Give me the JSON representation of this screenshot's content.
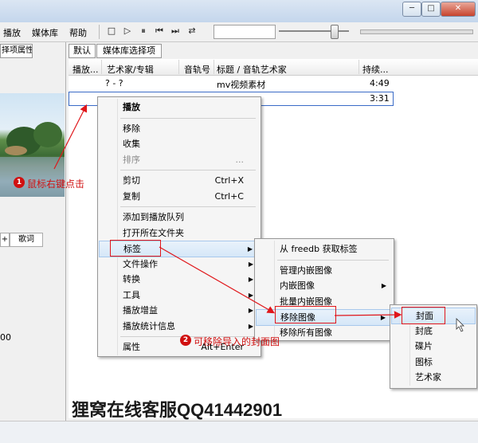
{
  "window": {
    "title": "",
    "buttons": [
      "─",
      "□",
      "✕"
    ]
  },
  "menubar": {
    "items": [
      "播放",
      "媒体库",
      "帮助"
    ]
  },
  "toolbar": {
    "icons": [
      "stop-icon",
      "play-icon",
      "pause-icon",
      "previous-icon",
      "next-icon",
      "random-icon"
    ],
    "glyphs": [
      "□",
      "▷",
      "⏸",
      "⏮",
      "⏭",
      "⇄"
    ],
    "volume_fraction": 0.78
  },
  "left_pane": {
    "tab": "择项属性",
    "lyric_tabs": [
      "+",
      "歌词"
    ],
    "number": "00"
  },
  "tabs": [
    "默认",
    "媒体库选择项"
  ],
  "columns": [
    "播放...",
    "艺术家/专辑",
    "音轨号",
    "标题 / 音轨艺术家",
    "持续..."
  ],
  "rows": [
    {
      "artist": "? - ?",
      "title": "mv视频素材",
      "duration": "4:49"
    },
    {
      "artist": "",
      "title": "",
      "duration": "3:31"
    }
  ],
  "context_menu": {
    "items": [
      {
        "label": "播放",
        "bold": true
      },
      {
        "sep": true
      },
      {
        "label": "移除"
      },
      {
        "label": "收集"
      },
      {
        "label": "排序",
        "shortcut": "...",
        "disabled": true
      },
      {
        "sep": true
      },
      {
        "label": "剪切",
        "shortcut": "Ctrl+X"
      },
      {
        "label": "复制",
        "shortcut": "Ctrl+C"
      },
      {
        "sep": true
      },
      {
        "label": "添加到播放队列"
      },
      {
        "label": "打开所在文件夹"
      },
      {
        "label": "标签",
        "submenu": true,
        "highlight": true
      },
      {
        "label": "文件操作",
        "submenu": true
      },
      {
        "label": "转换",
        "submenu": true
      },
      {
        "label": "工具",
        "submenu": true
      },
      {
        "label": "播放增益",
        "submenu": true
      },
      {
        "label": "播放统计信息",
        "submenu": true
      },
      {
        "sep": true
      },
      {
        "label": "属性",
        "shortcut": "Alt+Enter"
      }
    ]
  },
  "tag_submenu": {
    "items": [
      {
        "label": "从 freedb 获取标签"
      },
      {
        "sep": true
      },
      {
        "label": "管理内嵌图像"
      },
      {
        "label": "内嵌图像",
        "submenu": true
      },
      {
        "label": "批量内嵌图像"
      },
      {
        "label": "移除图像",
        "submenu": true,
        "highlight": true
      },
      {
        "label": "移除所有图像"
      }
    ]
  },
  "image_submenu": {
    "items": [
      {
        "label": "封面",
        "highlight": true
      },
      {
        "label": "封底"
      },
      {
        "label": "碟片"
      },
      {
        "label": "图标"
      },
      {
        "label": "艺术家"
      }
    ]
  },
  "annotations": {
    "step1": {
      "num": "1",
      "text": "鼠标右键点击"
    },
    "step2": {
      "num": "2",
      "text": "可移除导入的封面图"
    }
  },
  "watermark": {
    "cn": "狸窝在线客服",
    "qq": "QQ41442901"
  },
  "colors": {
    "annotation_red": "#e0161a",
    "menu_highlight": "#d6e7f8"
  }
}
